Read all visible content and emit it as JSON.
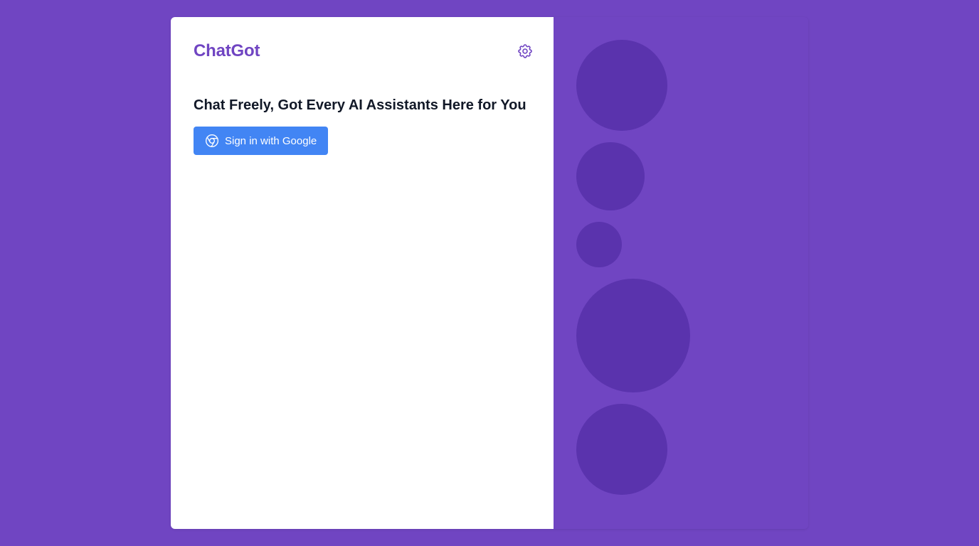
{
  "app": {
    "title": "ChatGot"
  },
  "header": {
    "settings_icon": "gear-icon"
  },
  "main": {
    "tagline": "Chat Freely, Got Every AI Assistants Here for You",
    "signin_label": "Sign in with Google",
    "signin_icon": "chrome-icon"
  },
  "colors": {
    "brand": "#7045c2",
    "brand_dark": "#5a33ad",
    "button": "#4285f4",
    "text_dark": "#111827",
    "panel_bg": "#ffffff"
  }
}
